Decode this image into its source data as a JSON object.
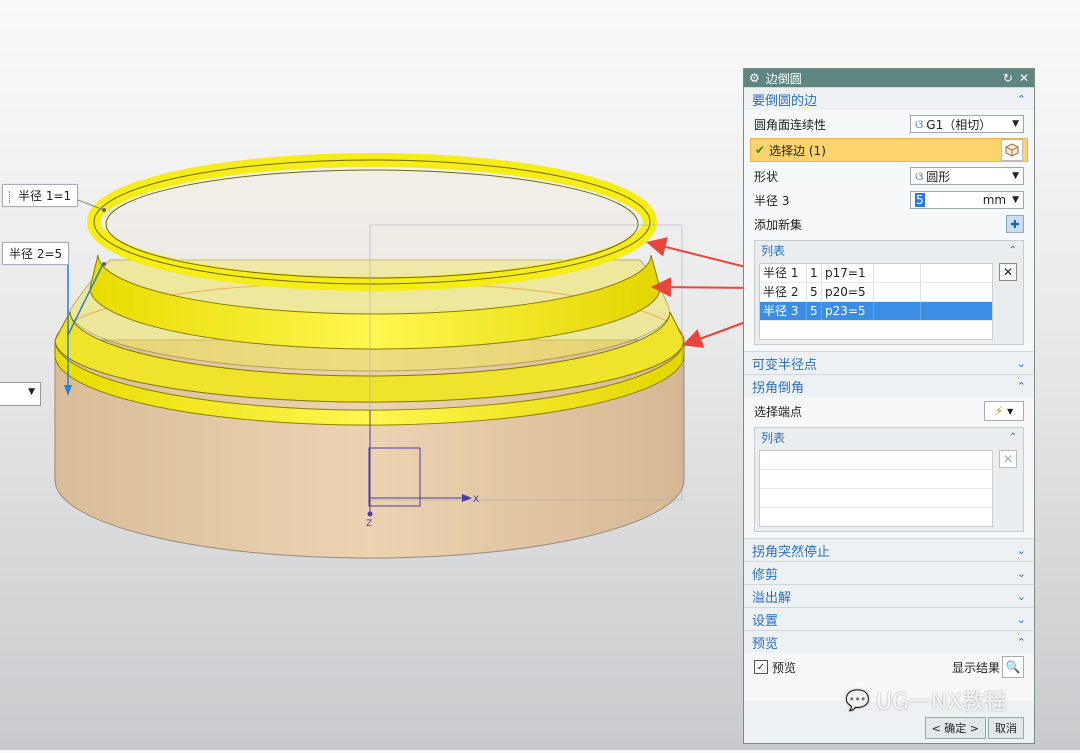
{
  "viewport": {
    "tags": [
      "半径 1=1",
      "半径 2=5"
    ],
    "axis_x": "X",
    "axis_z": "Z"
  },
  "dialog": {
    "title": "边倒圆",
    "sections": {
      "edges": {
        "title": "要倒圆的边",
        "continuity_label": "圆角面连续性",
        "continuity_value": "G1（相切）",
        "select_edge_label": "选择边 (1)",
        "shape_label": "形状",
        "shape_value": "圆形",
        "radius_label": "半径 3",
        "radius_value": "5",
        "radius_unit": "mm",
        "add_set_label": "添加新集",
        "list_title": "列表",
        "list_rows": [
          [
            "半径 1",
            "1",
            "p17=1"
          ],
          [
            "半径 2",
            "5",
            "p20=5"
          ],
          [
            "半径 3",
            "5",
            "p23=5"
          ]
        ]
      },
      "variable_radius": "可变半径点",
      "corner_setback": {
        "title": "拐角倒角",
        "select_end_label": "选择端点",
        "list_title": "列表"
      },
      "corner_stop": "拐角突然停止",
      "trim": "修剪",
      "overflow": "溢出解",
      "settings": "设置",
      "preview": {
        "title": "预览",
        "preview_label": "预览",
        "show_result_label": "显示结果"
      }
    },
    "ok_label": "< 确定 >",
    "cancel_label": "取消"
  },
  "watermark": "UG一NX教程",
  "colors": {
    "titlebar": "#5f8581",
    "section_text": "#2a70c0",
    "selection_highlight": "#fcd36d",
    "list_selected": "#3a8ee6",
    "fillet_yellow": "#f4e21a",
    "body_tan": "#e6c9a5",
    "arrow_red": "#e8463a"
  }
}
